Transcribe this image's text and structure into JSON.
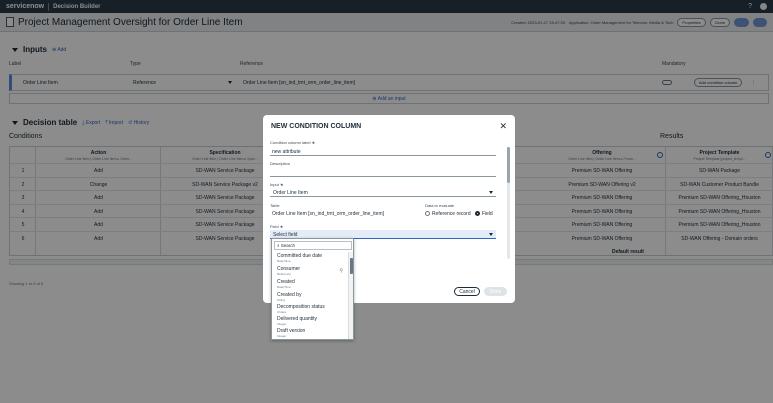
{
  "topbar": {
    "brand": "servicenow",
    "app": "Decision Builder"
  },
  "header": {
    "title": "Project Management Oversight for Order Line Item",
    "created": "Created: 2023-01-27 15:47:33",
    "application": "Application: Order Management for Telecom, Media & Tech",
    "properties": "Properties",
    "clone": "Clone"
  },
  "inputs": {
    "title": "Inputs",
    "add": "Add",
    "columns": {
      "label": "Label",
      "type": "Type",
      "reference": "Reference",
      "mandatory": "Mandatory"
    },
    "row": {
      "label": "Order Line Item",
      "type": "Reference",
      "reference": "Order Line Item [sn_ind_tmt_orm_order_line_item]",
      "add_condition": "Add condition column"
    },
    "add_input": "Add an input"
  },
  "decision_table": {
    "title": "Decision table",
    "export": "Export",
    "import": "Import",
    "history": "History",
    "conditions": "Conditions",
    "results": "Results",
    "columns": [
      {
        "name": "Action",
        "sub": "Order Line Item | Order Line Item ▸ Order..."
      },
      {
        "name": "Specification",
        "sub": "Order Line Item | Order Line Item ▸ Spec..."
      },
      {
        "name": "Offering",
        "sub": "Order Line Item | Order Line Item ▸ Produ..."
      },
      {
        "name": "Project Template",
        "sub": "Project Template [project_templ..."
      }
    ],
    "rows": [
      {
        "n": "1",
        "action": "Add",
        "spec": "SD-WAN Service Package",
        "offering": "Premium SD-WAN Offering",
        "template": "SD-WAN Package"
      },
      {
        "n": "2",
        "action": "Change",
        "spec": "SD-WAN Service Package v2",
        "offering": "Premium SD-WAN Offering v2",
        "template": "SD-WAN Customer Product Bundle"
      },
      {
        "n": "3",
        "action": "Add",
        "spec": "SD-WAN Service Package",
        "offering": "Premium SD-WAN Offering",
        "template": "Premium SD-WAN Offering_Houston"
      },
      {
        "n": "4",
        "action": "Add",
        "spec": "SD-WAN Service Package",
        "offering": "Premium SD-WAN Offering",
        "template": "Premium SD-WAN Offering_Houston"
      },
      {
        "n": "5",
        "action": "Add",
        "spec": "SD-WAN Service Package",
        "offering": "Premium SD-WAN Offering",
        "template": "Premium SD-WAN Offering_Houston"
      },
      {
        "n": "6",
        "action": "Add",
        "spec": "SD-WAN Service Package",
        "offering": "Premium SD-WAN Offering",
        "template": "SD-WAN Offering - Domain orders"
      }
    ],
    "default_result": "Default result",
    "showing": "Showing 1 to 6 of 6"
  },
  "modal": {
    "title": "NEW CONDITION COLUMN",
    "condition_label_label": "Condition column label ★",
    "condition_label_value": "new attribute",
    "description_label": "Description",
    "input_label": "Input ★",
    "input_value": "Order Line Item",
    "table_label": "Table",
    "table_value": "Order Line Item [sn_ind_tmt_orm_order_line_item]",
    "data_to_evaluate_label": "Data to evaluate",
    "reference_record": "Reference record",
    "field": "Field",
    "field_label": "Field ★",
    "field_value": "Select field",
    "search_placeholder": "Search",
    "options": [
      {
        "name": "Committed due date",
        "type": "Date/Time"
      },
      {
        "name": "Consumer",
        "type": "Reference"
      },
      {
        "name": "Created",
        "type": "Date/Time"
      },
      {
        "name": "Created by",
        "type": "String"
      },
      {
        "name": "Decomposition status",
        "type": "Choice"
      },
      {
        "name": "Delivered quantity",
        "type": "Integer"
      },
      {
        "name": "Draft version",
        "type": "Integer"
      }
    ],
    "cancel": "Cancel",
    "done": "Done"
  }
}
